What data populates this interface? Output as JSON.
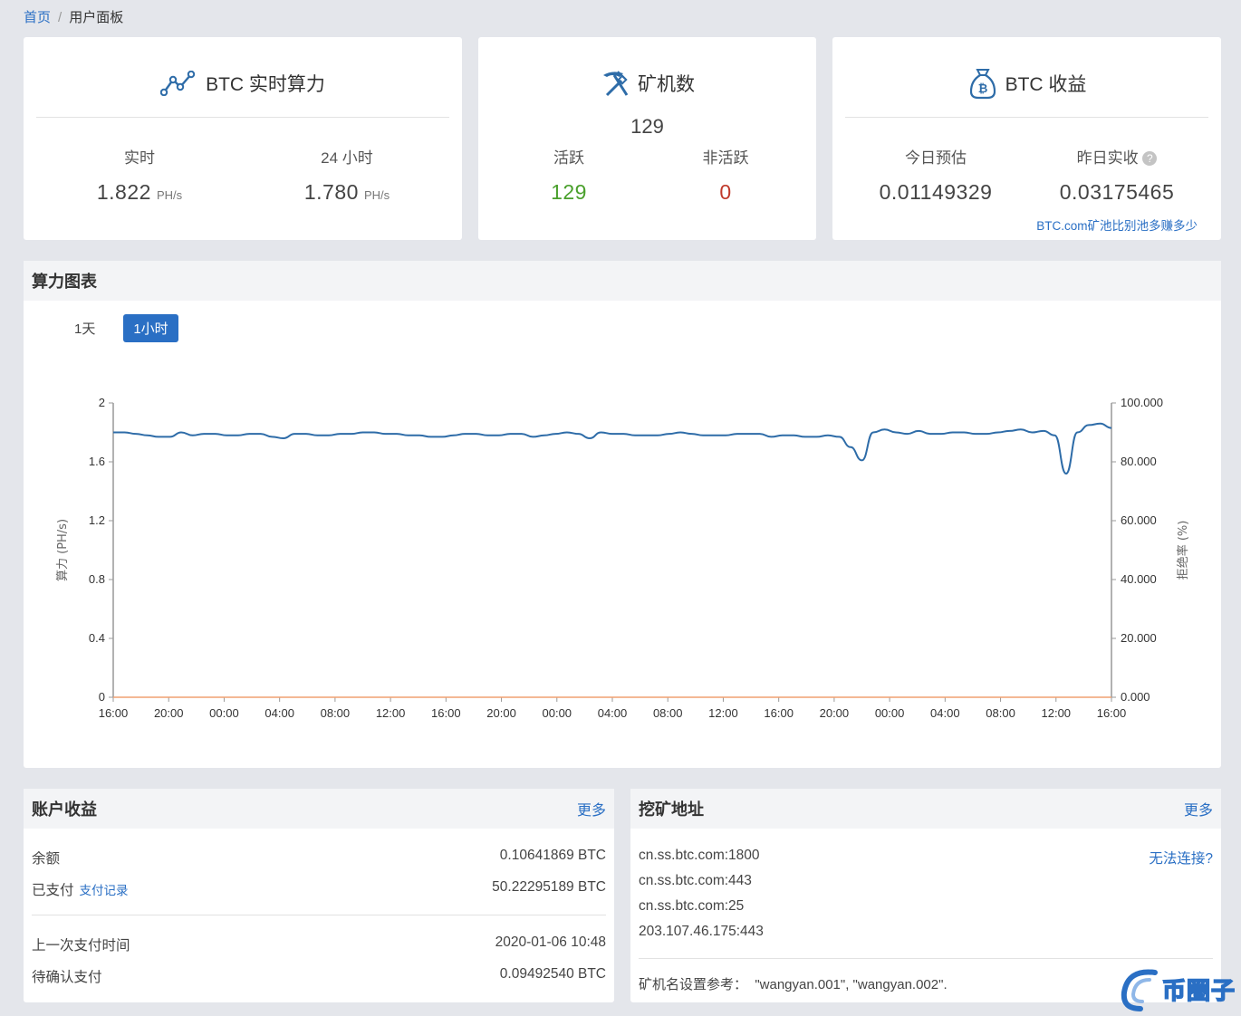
{
  "breadcrumb": {
    "home": "首页",
    "separator": "/",
    "current": "用户面板"
  },
  "hashrate_card": {
    "title": "BTC 实时算力",
    "icon": "line-chart-icon",
    "realtime_label": "实时",
    "realtime_value": "1.822",
    "day_label": "24 小时",
    "day_value": "1.780",
    "unit": "PH/s"
  },
  "miners_card": {
    "title": "矿机数",
    "icon": "pickaxe-icon",
    "total": "129",
    "active_label": "活跃",
    "active_value": "129",
    "inactive_label": "非活跃",
    "inactive_value": "0"
  },
  "earnings_card": {
    "title": "BTC 收益",
    "icon": "bitcoin-bag-icon",
    "today_label": "今日预估",
    "today_value": "0.01149329",
    "yesterday_label": "昨日实收",
    "yesterday_value": "0.03175465",
    "compare_link": "BTC.com矿池比别池多赚多少"
  },
  "chart_panel": {
    "title": "算力图表",
    "tabs": [
      "1天",
      "1小时"
    ],
    "active_tab": "1小时"
  },
  "chart_data": {
    "type": "line",
    "x_ticks": [
      "16:00",
      "20:00",
      "00:00",
      "04:00",
      "08:00",
      "12:00",
      "16:00",
      "20:00",
      "00:00",
      "04:00",
      "08:00",
      "12:00",
      "16:00",
      "20:00",
      "00:00",
      "04:00",
      "08:00",
      "12:00",
      "16:00"
    ],
    "ylabel_left": "算力 (PH/s)",
    "ylabel_right": "拒绝率 (%)",
    "ylim_left": [
      0,
      2
    ],
    "ylim_right": [
      0,
      100
    ],
    "yticks_left": [
      "0",
      "0.4",
      "0.8",
      "1.2",
      "1.6",
      "2"
    ],
    "yticks_right": [
      "0.000",
      "20.000",
      "40.000",
      "60.000",
      "80.000",
      "100.000"
    ],
    "series": [
      {
        "color": "#2e6ca8",
        "axis": "left",
        "values": [
          1.8,
          1.8,
          1.79,
          1.78,
          1.77,
          1.77,
          1.8,
          1.78,
          1.79,
          1.79,
          1.78,
          1.78,
          1.79,
          1.79,
          1.77,
          1.76,
          1.79,
          1.79,
          1.78,
          1.78,
          1.79,
          1.79,
          1.8,
          1.8,
          1.79,
          1.79,
          1.78,
          1.78,
          1.77,
          1.77,
          1.78,
          1.79,
          1.79,
          1.78,
          1.78,
          1.79,
          1.79,
          1.77,
          1.78,
          1.79,
          1.8,
          1.79,
          1.76,
          1.8,
          1.79,
          1.79,
          1.78,
          1.78,
          1.78,
          1.79,
          1.8,
          1.79,
          1.78,
          1.78,
          1.78,
          1.79,
          1.79,
          1.79,
          1.77,
          1.78,
          1.78,
          1.77,
          1.77,
          1.78,
          1.77,
          1.7,
          1.61,
          1.8,
          1.82,
          1.8,
          1.79,
          1.81,
          1.79,
          1.79,
          1.8,
          1.8,
          1.79,
          1.79,
          1.8,
          1.81,
          1.82,
          1.8,
          1.81,
          1.78,
          1.52,
          1.8,
          1.85,
          1.86,
          1.83
        ]
      },
      {
        "color": "#f0a070",
        "axis": "right",
        "values": [
          0,
          0,
          0,
          0,
          0,
          0,
          0,
          0,
          0,
          0,
          0,
          0,
          0,
          0,
          0,
          0,
          0,
          0,
          0
        ]
      }
    ],
    "grid": false
  },
  "account_panel": {
    "title": "账户收益",
    "more": "更多",
    "balance_label": "余额",
    "balance_value": "0.10641869 BTC",
    "paid_label": "已支付",
    "paid_link": "支付记录",
    "paid_value": "50.22295189 BTC",
    "last_pay_label": "上一次支付时间",
    "last_pay_value": "2020-01-06 10:48",
    "pending_label": "待确认支付",
    "pending_value": "0.09492540 BTC"
  },
  "mining_panel": {
    "title": "挖矿地址",
    "more": "更多",
    "help_link": "无法连接?",
    "addresses": [
      "cn.ss.btc.com:1800",
      "cn.ss.btc.com:443",
      "cn.ss.btc.com:25",
      "203.107.46.175:443"
    ],
    "worker_hint": "矿机名设置参考：  \"wangyan.001\", \"wangyan.002\"."
  },
  "watermark": {
    "text": "币圈子",
    "color": "#2a6fc4"
  }
}
